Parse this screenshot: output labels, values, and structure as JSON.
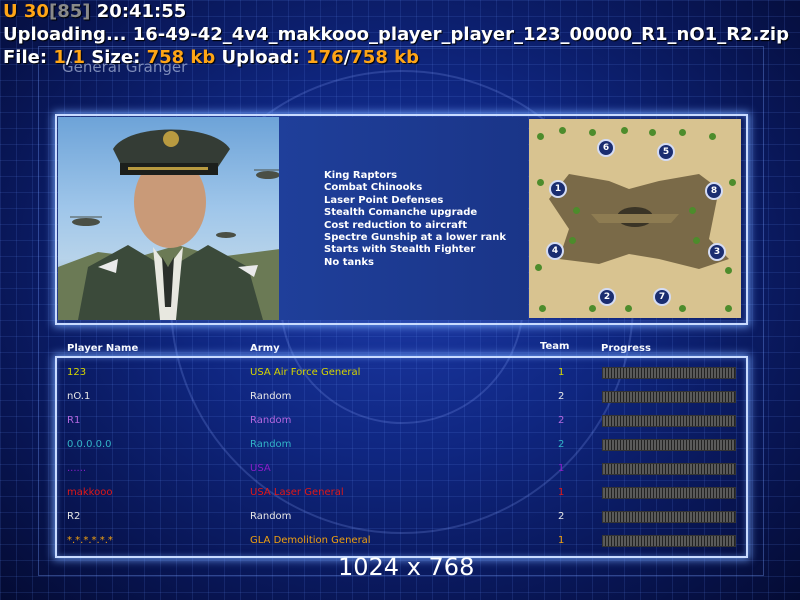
{
  "hud": {
    "line1": {
      "u": "U",
      "fps": "30",
      "limit": "[85]",
      "time": "20:41:55"
    },
    "line2": "Uploading... 16-49-42_4v4_makkooo_player_player_123_00000_R1_nO1_R2.zip",
    "line3": {
      "file_label": "File:",
      "file_cur": "1",
      "file_total": "1",
      "size_label": "Size:",
      "size": "758 kb",
      "upload_label": "Upload:",
      "upload_cur": "176",
      "upload_total": "758 kb"
    }
  },
  "screen_title": "General Granger",
  "general_features": [
    "King Raptors",
    "Combat Chinooks",
    "Laser Point Defenses",
    "Stealth Comanche upgrade",
    "Cost reduction to aircraft",
    "Spectre Gunship at a lower rank",
    "Starts with Stealth Fighter",
    "No tanks"
  ],
  "map": {
    "start_positions": [
      "1",
      "2",
      "3",
      "4",
      "5",
      "6",
      "7",
      "8"
    ]
  },
  "table": {
    "headers": {
      "player": "Player Name",
      "army": "Army",
      "team": "Team",
      "progress": "Progress"
    },
    "rows": [
      {
        "name": "123",
        "army": "USA Air Force General",
        "team": "1",
        "color": "#d6d600"
      },
      {
        "name": "nO.1",
        "army": "Random",
        "team": "2",
        "color": "#e8e8e8"
      },
      {
        "name": "R1",
        "army": "Random",
        "team": "2",
        "color": "#b468e0"
      },
      {
        "name": "0.0.0.0.0",
        "army": "Random",
        "team": "2",
        "color": "#32b4c8"
      },
      {
        "name": "......",
        "army": "USA",
        "team": "1",
        "color": "#8a1cc8"
      },
      {
        "name": "makkooo",
        "army": "USA Laser General",
        "team": "1",
        "color": "#e01818"
      },
      {
        "name": "R2",
        "army": "Random",
        "team": "2",
        "color": "#e8e8e8"
      },
      {
        "name": "*.*.*.*.*.*",
        "army": "GLA Demolition General",
        "team": "1",
        "color": "#f0a010"
      }
    ]
  },
  "resolution": "1024 x 768"
}
